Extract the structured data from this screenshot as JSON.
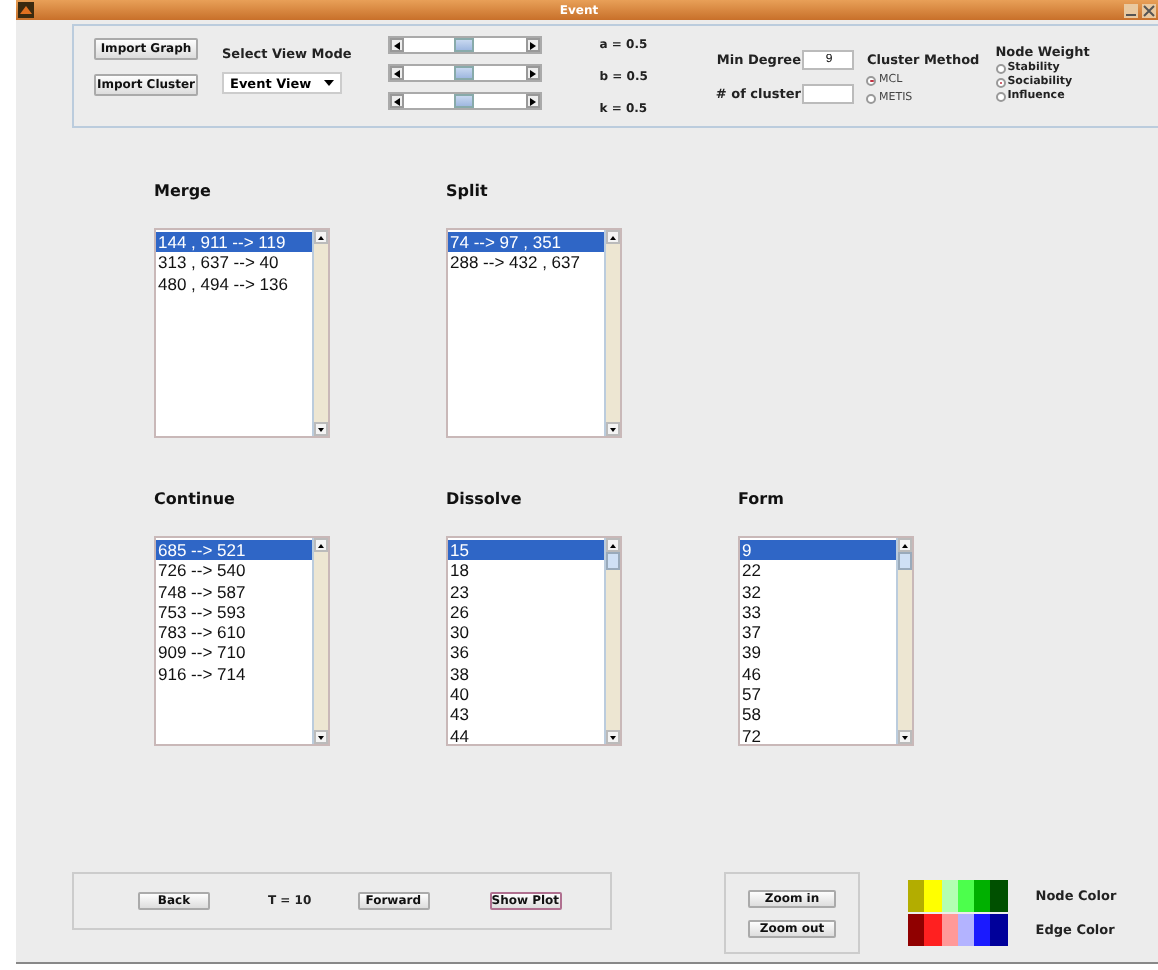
{
  "window": {
    "title": "Event"
  },
  "toolbar": {
    "buttons": [
      "Import Graph",
      "Import Cluster"
    ],
    "view_mode": {
      "label": "Select View Mode",
      "value": "Event View"
    },
    "sliders": [
      {
        "reading": "a = 0.5",
        "level": 0.5
      },
      {
        "reading": "b = 0.5",
        "level": 0.5
      },
      {
        "reading": "k = 0.5",
        "level": 0.5
      }
    ],
    "fields": [
      {
        "label": "Min Degree",
        "value": "9"
      },
      {
        "label": "# of cluster"
      }
    ],
    "cluster_method": {
      "label": "Cluster Method",
      "options": [
        {
          "label": "MCL",
          "selected": true
        },
        {
          "label": "METIS",
          "selected": false
        }
      ]
    },
    "node_weight": {
      "label": "Node Weight",
      "options": [
        {
          "label": "Stability",
          "selected": false
        },
        {
          "label": "Sociability",
          "selected": true
        },
        {
          "label": "Influence",
          "selected": false
        }
      ]
    }
  },
  "lists": [
    {
      "title": "Merge",
      "items": [
        {
          "text": "144 , 911 --> 119",
          "selected": true
        },
        {
          "text": "313 , 637 --> 40",
          "selected": false
        },
        {
          "text": "480 , 494 --> 136",
          "selected": false
        }
      ]
    },
    {
      "title": "Split",
      "items": [
        {
          "text": "74 --> 97 , 351",
          "selected": true
        },
        {
          "text": "288 --> 432 , 637",
          "selected": false
        }
      ]
    },
    {
      "title": "Continue",
      "items": [
        {
          "text": "685 --> 521",
          "selected": true
        },
        {
          "text": "726 --> 540",
          "selected": false
        },
        {
          "text": "748 --> 587",
          "selected": false
        },
        {
          "text": "753 --> 593",
          "selected": false
        },
        {
          "text": "783 --> 610",
          "selected": false
        },
        {
          "text": "909 --> 710",
          "selected": false
        },
        {
          "text": "916 --> 714",
          "selected": false
        }
      ]
    },
    {
      "title": "Dissolve",
      "items": [
        {
          "text": "15",
          "selected": true
        },
        {
          "text": "18",
          "selected": false
        },
        {
          "text": "23",
          "selected": false
        },
        {
          "text": "26",
          "selected": false
        },
        {
          "text": "30",
          "selected": false
        },
        {
          "text": "36",
          "selected": false
        },
        {
          "text": "38",
          "selected": false
        },
        {
          "text": "40",
          "selected": false
        },
        {
          "text": "43",
          "selected": false
        },
        {
          "text": "44",
          "selected": false
        }
      ]
    },
    {
      "title": "Form",
      "items": [
        {
          "text": "9",
          "selected": true
        },
        {
          "text": "22",
          "selected": false
        },
        {
          "text": "32",
          "selected": false
        },
        {
          "text": "33",
          "selected": false
        },
        {
          "text": "37",
          "selected": false
        },
        {
          "text": "39",
          "selected": false
        },
        {
          "text": "46",
          "selected": false
        },
        {
          "text": "57",
          "selected": false
        },
        {
          "text": "58",
          "selected": false
        },
        {
          "text": "72",
          "selected": false
        }
      ]
    }
  ],
  "navigation": {
    "back": "Back",
    "time": "T = 10",
    "forward": "Forward",
    "show_plot": "Show Plot"
  },
  "zoom": [
    "Zoom in",
    "Zoom out"
  ],
  "legend": [
    {
      "label": "Node Color",
      "colors": [
        {
          "color": "#b3ad00"
        },
        {
          "color": "#ffff00"
        },
        {
          "color": "#b3ffb3"
        },
        {
          "color": "#4cff4c"
        },
        {
          "color": "#00b000"
        },
        {
          "color": "#005000"
        }
      ]
    },
    {
      "label": "Edge Color",
      "colors": [
        {
          "color": "#900000"
        },
        {
          "color": "#ff2020"
        },
        {
          "color": "#ff9999"
        },
        {
          "color": "#b3b3ff"
        },
        {
          "color": "#1a1aff"
        },
        {
          "color": "#00009a"
        }
      ]
    }
  ]
}
